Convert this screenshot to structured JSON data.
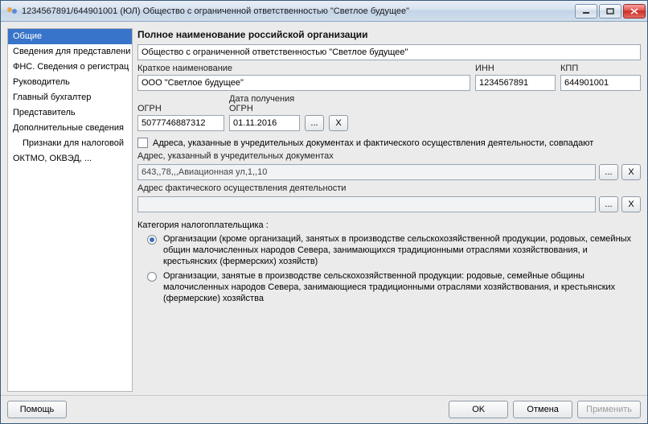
{
  "window": {
    "title": "1234567891/644901001 (ЮЛ) Общество с ограниченной ответственностью \"Светлое будущее\""
  },
  "sidebar": {
    "items": [
      {
        "label": "Общие",
        "selected": true
      },
      {
        "label": "Сведения для представлени"
      },
      {
        "label": "ФНС. Сведения о регистрац"
      },
      {
        "label": "Руководитель"
      },
      {
        "label": "Главный бухгалтер"
      },
      {
        "label": "Представитель"
      },
      {
        "label": "Дополнительные сведения"
      },
      {
        "label": "Признаки для налоговой",
        "indent": true
      },
      {
        "label": "ОКТМО, ОКВЭД, ..."
      }
    ]
  },
  "main": {
    "section_title": "Полное наименование российской организации",
    "full_name": "Общество с ограниченной ответственностью \"Светлое будущее\"",
    "short_name_label": "Краткое наименование",
    "short_name": "ООО \"Светлое будущее\"",
    "inn_label": "ИНН",
    "inn": "1234567891",
    "kpp_label": "КПП",
    "kpp": "644901001",
    "ogrn_label": "ОГРН",
    "ogrn": "5077746887312",
    "ogrn_date_label": "Дата получения ОГРН",
    "ogrn_date": "01.11.2016",
    "dots": "...",
    "x": "X",
    "same_addr_label": "Адреса, указанные в учредительных документах и фактического осуществления деятельности, совпадают",
    "addr1_label": "Адрес, указанный в учредительных документах",
    "addr1": "643,,78,,,Авиационная ул,1,,10",
    "addr2_label": "Адрес фактического осуществления деятельности",
    "addr2": "",
    "category_label": "Категория налогоплательщика :",
    "radio1": "Организации (кроме организаций, занятых в производстве сельскохозяйственной продукции, родовых, семейных общин малочисленных народов Севера, занимающихся традиционными отраслями хозяйствования, и крестьянских (фермерских) хозяйств)",
    "radio2": "Организации, занятые в производстве сельскохозяйственной продукции: родовые, семейные общины малочисленных народов Севера, занимающиеся традиционными отраслями хозяйствования, и крестьянских (фермерские) хозяйства"
  },
  "footer": {
    "help": "Помощь",
    "ok": "OK",
    "cancel": "Отмена",
    "apply": "Применить"
  }
}
